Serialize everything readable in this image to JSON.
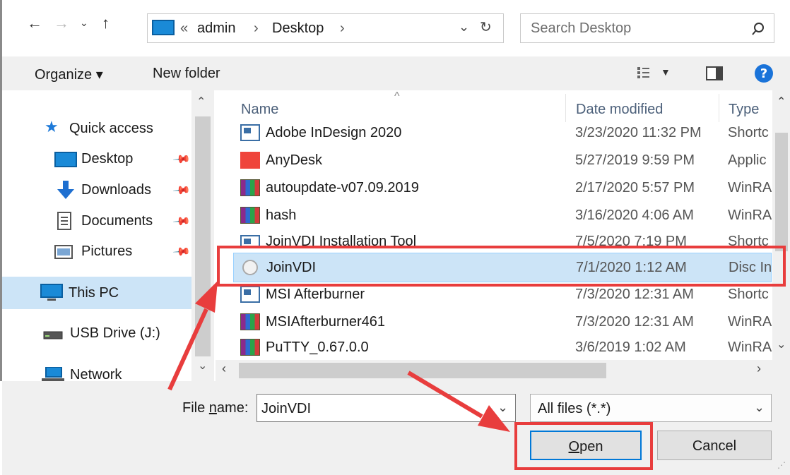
{
  "address_bar": {
    "overflow": "«",
    "path": [
      "admin",
      "Desktop"
    ],
    "separator": "›"
  },
  "search": {
    "placeholder": "Search Desktop"
  },
  "toolbar": {
    "organize_label": "Organize ▾",
    "new_folder_label": "New folder"
  },
  "sidebar": {
    "items": [
      {
        "label": "Quick access",
        "icon": "star-icon"
      },
      {
        "label": "Desktop",
        "icon": "desktop-icon",
        "pinned": true
      },
      {
        "label": "Downloads",
        "icon": "download-arrow-icon",
        "pinned": true
      },
      {
        "label": "Documents",
        "icon": "documents-icon",
        "pinned": true
      },
      {
        "label": "Pictures",
        "icon": "pictures-icon",
        "pinned": true
      },
      {
        "label": "This PC",
        "icon": "computer-icon",
        "selected": true
      },
      {
        "label": "USB Drive (J:)",
        "icon": "usb-drive-icon"
      },
      {
        "label": "Network",
        "icon": "network-icon"
      }
    ]
  },
  "file_list": {
    "columns": {
      "name": "Name",
      "date": "Date modified",
      "type": "Type"
    },
    "rows": [
      {
        "name": "Adobe InDesign 2020",
        "date": "3/23/2020 11:32 PM",
        "type": "Shortc",
        "icon": "shortcut-icon"
      },
      {
        "name": "AnyDesk",
        "date": "5/27/2019 9:59 PM",
        "type": "Applic",
        "icon": "anydesk-icon"
      },
      {
        "name": "autoupdate-v07.09.2019",
        "date": "2/17/2020 5:57 PM",
        "type": "WinRA",
        "icon": "winrar-icon"
      },
      {
        "name": "hash",
        "date": "3/16/2020 4:06 AM",
        "type": "WinRA",
        "icon": "winrar-icon"
      },
      {
        "name": "JoinVDI Installation Tool",
        "date": "7/5/2020 7:19 PM",
        "type": "Shortc",
        "icon": "shortcut-icon"
      },
      {
        "name": "JoinVDI",
        "date": "7/1/2020 1:12 AM",
        "type": "Disc In",
        "icon": "disc-image-icon",
        "selected": true
      },
      {
        "name": "MSI Afterburner",
        "date": "7/3/2020 12:31 AM",
        "type": "Shortc",
        "icon": "shortcut-icon"
      },
      {
        "name": "MSIAfterburner461",
        "date": "7/3/2020 12:31 AM",
        "type": "WinRA",
        "icon": "winrar-icon"
      },
      {
        "name": "PuTTY_0.67.0.0",
        "date": "3/6/2019 1:02 AM",
        "type": "WinRA",
        "icon": "winrar-icon"
      }
    ]
  },
  "footer": {
    "file_name_label_pre": "File ",
    "file_name_label_u": "n",
    "file_name_label_post": "ame:",
    "file_name_value": "JoinVDI",
    "file_type_value": "All files (*.*)",
    "open_label_u": "O",
    "open_label_rest": "pen",
    "cancel_label": "Cancel"
  },
  "colors": {
    "annotation_red": "#e83d3d",
    "selection_blue": "#cce4f7",
    "accent": "#0078d7"
  }
}
